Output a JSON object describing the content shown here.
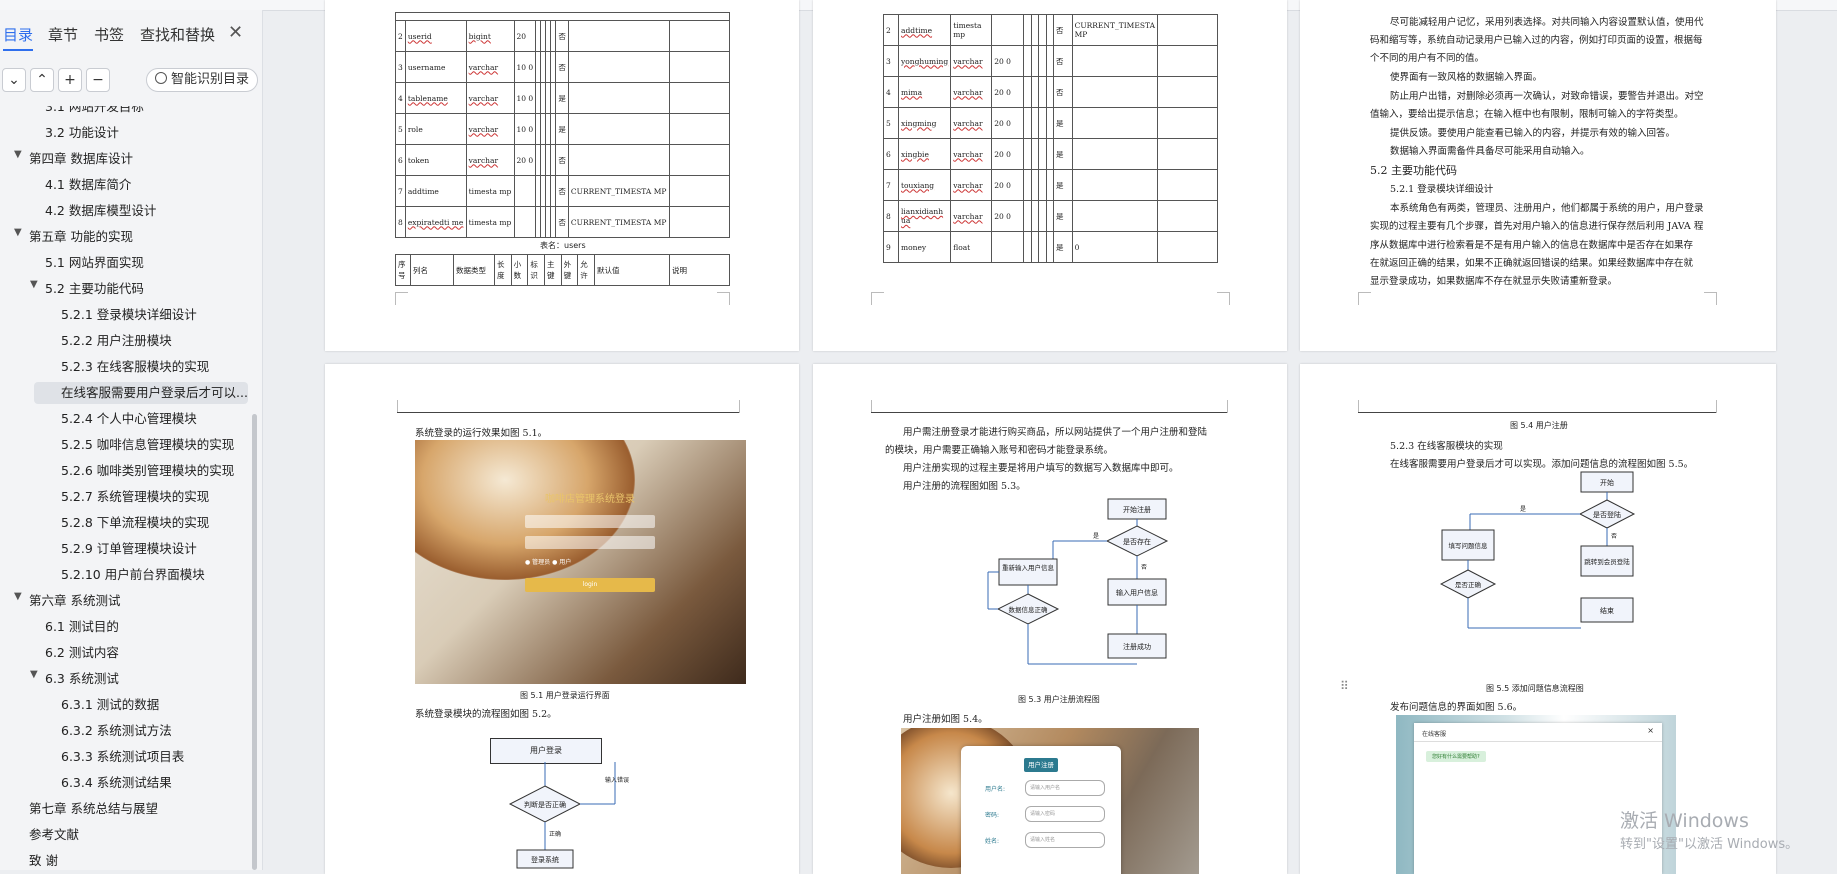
{
  "sidebar": {
    "tabs": [
      "目录",
      "章节",
      "书签",
      "查找和替换"
    ],
    "ai_button": "智能识别目录",
    "toc": [
      {
        "label": "3.1 网站开发目标"
      },
      {
        "label": "3.2 功能设计"
      },
      {
        "label": "第四章 数据库设计"
      },
      {
        "label": "4.1 数据库简介"
      },
      {
        "label": "4.2 数据库模型设计"
      },
      {
        "label": "第五章 功能的实现"
      },
      {
        "label": "5.1 网站界面实现"
      },
      {
        "label": "5.2 主要功能代码"
      },
      {
        "label": "5.2.1 登录模块详细设计"
      },
      {
        "label": "5.2.2 用户注册模块"
      },
      {
        "label": "5.2.3 在线客服模块的实现"
      },
      {
        "label": "在线客服需要用户登录后才可以..."
      },
      {
        "label": "5.2.4 个人中心管理模块"
      },
      {
        "label": "5.2.5 咖啡信息管理模块的实现"
      },
      {
        "label": "5.2.6 咖啡类别管理模块的实现"
      },
      {
        "label": "5.2.7 系统管理模块的实现"
      },
      {
        "label": "5.2.8 下单流程模块的实现"
      },
      {
        "label": "5.2.9 订单管理模块设计"
      },
      {
        "label": "5.2.10 用户前台界面模块"
      },
      {
        "label": "第六章 系统测试"
      },
      {
        "label": "6.1 测试目的"
      },
      {
        "label": "6.2 测试内容"
      },
      {
        "label": "6.3 系统测试"
      },
      {
        "label": "6.3.1 测试的数据"
      },
      {
        "label": "6.3.2 系统测试方法"
      },
      {
        "label": "6.3.3 系统测试项目表"
      },
      {
        "label": "6.3.4 系统测试结果"
      },
      {
        "label": "第七章 系统总结与展望"
      },
      {
        "label": "参考文献"
      },
      {
        "label": "致 谢"
      }
    ]
  },
  "page1": {
    "rows": [
      {
        "no": "2",
        "name": "userid",
        "type": "bigint",
        "len": "20",
        "flag": "否",
        "def": ""
      },
      {
        "no": "3",
        "name": "username",
        "type": "varchar",
        "len": "10 0",
        "flag": "否",
        "def": ""
      },
      {
        "no": "4",
        "name": "tablename",
        "type": "varchar",
        "len": "10 0",
        "flag": "是",
        "def": ""
      },
      {
        "no": "5",
        "name": "role",
        "type": "varchar",
        "len": "10 0",
        "flag": "是",
        "def": ""
      },
      {
        "no": "6",
        "name": "token",
        "type": "varchar",
        "len": "20 0",
        "flag": "否",
        "def": ""
      },
      {
        "no": "7",
        "name": "addtime",
        "type": "timesta mp",
        "len": "",
        "flag": "否",
        "def": "CURRENT_TIMESTA MP"
      },
      {
        "no": "8",
        "name": "expiratedti me",
        "type": "timesta mp",
        "len": "",
        "flag": "否",
        "def": "CURRENT_TIMESTA MP"
      }
    ],
    "caption": "表名：users",
    "header_row": [
      "序号",
      "列名",
      "数据类型",
      "长度",
      "小数",
      "标识",
      "主键",
      "外键",
      "允许",
      "默认值",
      "说明"
    ]
  },
  "page2": {
    "rows": [
      {
        "no": "2",
        "name": "addtime",
        "type": "timesta mp",
        "len": "",
        "flag": "否",
        "def": "CURRENT_TIMESTA MP"
      },
      {
        "no": "3",
        "name": "yonghuming",
        "type": "varchar",
        "len": "20 0",
        "flag": "否",
        "def": ""
      },
      {
        "no": "4",
        "name": "mima",
        "type": "varchar",
        "len": "20 0",
        "flag": "否",
        "def": ""
      },
      {
        "no": "5",
        "name": "xingming",
        "type": "varchar",
        "len": "20 0",
        "flag": "是",
        "def": ""
      },
      {
        "no": "6",
        "name": "xingbie",
        "type": "varchar",
        "len": "20 0",
        "flag": "是",
        "def": ""
      },
      {
        "no": "7",
        "name": "touxiang",
        "type": "varchar",
        "len": "20 0",
        "flag": "是",
        "def": ""
      },
      {
        "no": "8",
        "name": "lianxidianh ua",
        "type": "varchar",
        "len": "20 0",
        "flag": "是",
        "def": ""
      },
      {
        "no": "9",
        "name": "money",
        "type": "float",
        "len": "",
        "flag": "是",
        "def": "0"
      }
    ]
  },
  "page3": {
    "lines": [
      "尽可能减轻用户记忆，采用列表选择。对共同输入内容设置默认值，使用代",
      "码和缩写等，系统自动记录用户已输入过的内容，例如打印页面的设置，根据每",
      "个不同的用户有不同的值。",
      "使界面有一致风格的数据输入界面。",
      "防止用户出错，对删除必须再一次确认，对致命错误，要警告并退出。对空",
      "值输入，要给出提示信息；在输入框中也有限制，限制可输入的字符类型。",
      "提供反馈。要使用户能查看已输入的内容，并提示有效的输入回答。",
      "数据输入界面需备件具备尽可能采用自动输入。",
      "5.2 主要功能代码",
      "5.2.1 登录模块详细设计",
      "本系统角色有两类，管理员、注册用户，他们都属于系统的用户，用户登录",
      "实现的过程主要有几个步骤，首先对用户输入的信息进行保存然后利用 JAVA 程",
      "序从数据库中进行检索看是不是有用户输入的信息在数据库中是否存在如果存",
      "在就返回正确的结果，如果不正确就返回错误的结果。如果经数据库中存在就",
      "显示登录成功，如果数据库不存在就显示失败请重新登录。"
    ]
  },
  "page4": {
    "intro": "系统登录的运行效果如图 5.1。",
    "login_title": "咖啡店管理系统登录",
    "login_btn": "login",
    "radio1": "管理员",
    "radio2": "用户",
    "caption": "图 5.1 用户登录运行界面",
    "flow_intro": "系统登录模块的流程图如图 5.2。",
    "flow": {
      "start": "用户登录",
      "decision": "判断是否正确",
      "yes": "正确",
      "no": "输入错误",
      "end": "登录系统"
    }
  },
  "page5": {
    "lines": [
      "用户需注册登录才能进行购买商品，所以网站提供了一个用户注册和登陆",
      "的模块，用户需要正确输入账号和密码才能登录系统。",
      "用户注册实现的过程主要是将用户填写的数据写入数据库中即可。",
      "用户注册的流程图如图 5.3。"
    ],
    "flow": {
      "start": "开始注册",
      "exists": "是否存在",
      "reinput": "重新输入用户信息",
      "input": "输入用户信息",
      "check": "数据信息正确",
      "success": "注册成功",
      "yes": "是",
      "no": "否"
    },
    "caption": "图 5.3 用户注册流程图",
    "reg_intro": "用户注册如图 5.4。",
    "reg_title": "用户注册",
    "fields": [
      {
        "label": "用户名:",
        "placeholder": "请输入用户名"
      },
      {
        "label": "密码:",
        "placeholder": "请输入密码"
      },
      {
        "label": "姓名:",
        "placeholder": "请输入姓名"
      }
    ]
  },
  "page6": {
    "top_caption": "图 5.4 用户注册",
    "heading": "5.2.3 在线客服模块的实现",
    "line": "在线客服需要用户登录后才可以实现。添加问题信息的流程图如图 5.5。",
    "flow": {
      "start": "开始",
      "login": "是否登陆",
      "fill": "填写问题信息",
      "jump": "跳转到会员登陆",
      "correct": "是否正确",
      "end": "结束",
      "yes": "是",
      "no": "否"
    },
    "caption": "图 5.5 添加问题信息流程图",
    "publish": "发布问题信息的界面如图 5.6。",
    "dialog_title": "在线客服",
    "dialog_msg": "您好有什么需要帮助?"
  },
  "watermark": {
    "line1": "激活 Windows",
    "line2": "转到\"设置\"以激活 Windows。"
  }
}
